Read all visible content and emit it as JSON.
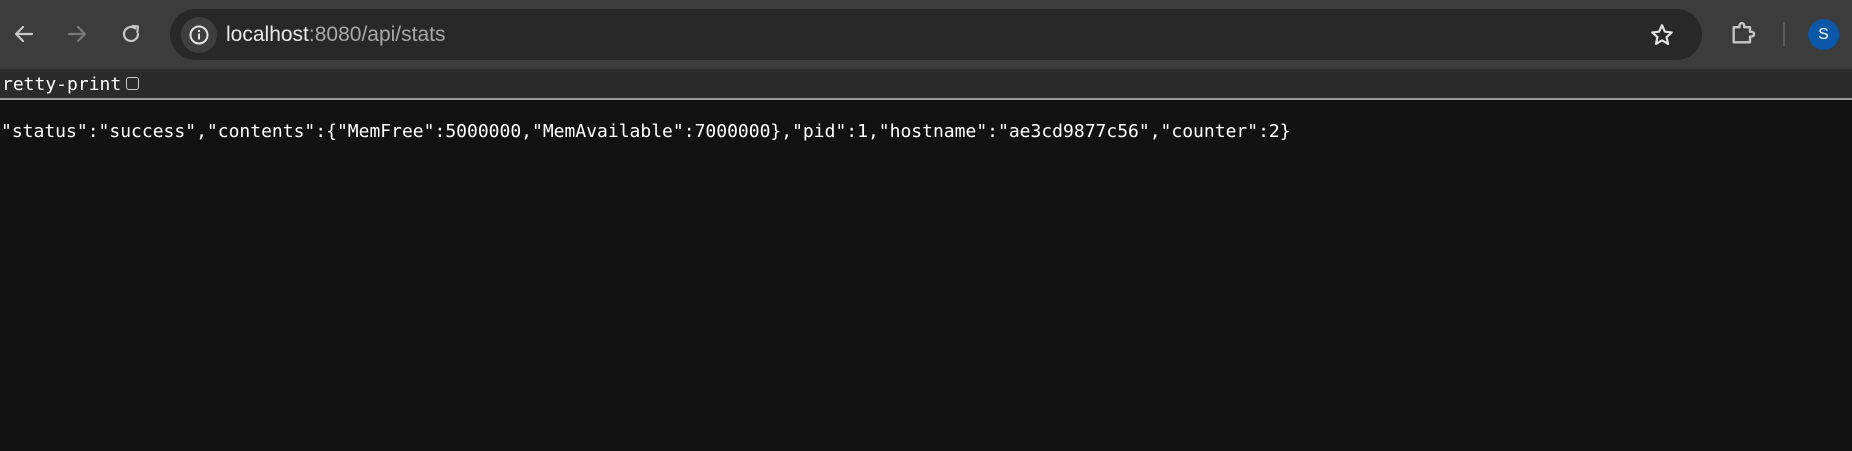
{
  "browser": {
    "url_host": "localhost",
    "url_path": ":8080/api/stats",
    "avatar_initial": "S",
    "icons": {
      "back": "arrow-left-icon",
      "forward": "arrow-right-icon",
      "reload": "reload-icon",
      "site_info": "info-icon",
      "bookmark": "star-icon",
      "extensions": "puzzle-icon"
    },
    "colors": {
      "toolbar": "#3c3c3c",
      "omnibox": "#282828",
      "avatar": "#0b57a8",
      "page_background": "#121212"
    }
  },
  "viewer": {
    "pretty_print_label": "retty-print",
    "pretty_print_checked": false,
    "json_text": "\"status\":\"success\",\"contents\":{\"MemFree\":5000000,\"MemAvailable\":7000000},\"pid\":1,\"hostname\":\"ae3cd9877c56\",\"counter\":2}"
  }
}
